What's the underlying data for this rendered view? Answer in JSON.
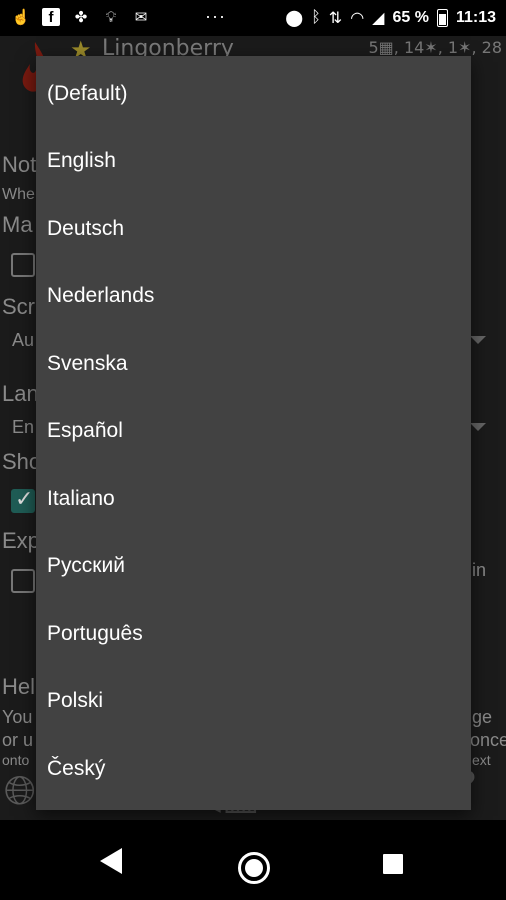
{
  "status_bar": {
    "icons_left": [
      "hand-icon",
      "facebook-icon",
      "puzzle-icon",
      "bulb-icon",
      "mail-icon"
    ],
    "overflow": "···",
    "battery_percent": "65 %",
    "time": "11:13"
  },
  "app": {
    "title": "Lingonberry",
    "stats": "5▦, 14✶, 1✶, 28",
    "background_labels": {
      "notifications": "Not",
      "when": "Whe",
      "ma": "Ma",
      "scr": "Scr",
      "au": "Au",
      "lan": "Lan",
      "en": "En",
      "sho": "Sho",
      "exp": "Exp",
      "in": "in",
      "help": "Hel",
      "you": "You",
      "or_u": "or u",
      "ge": "ge",
      "once": "once",
      "onto": "onto",
      "ext": "ext"
    }
  },
  "language_menu": {
    "items": [
      "(Default)",
      "English",
      "Deutsch",
      "Nederlands",
      "Svenska",
      "Español",
      "Italiano",
      "Русский",
      "Português",
      "Polski",
      "Český"
    ]
  },
  "colors": {
    "menu_bg": "#424242",
    "app_bg": "#1b1b1b",
    "check_accent": "#1f5c55"
  }
}
